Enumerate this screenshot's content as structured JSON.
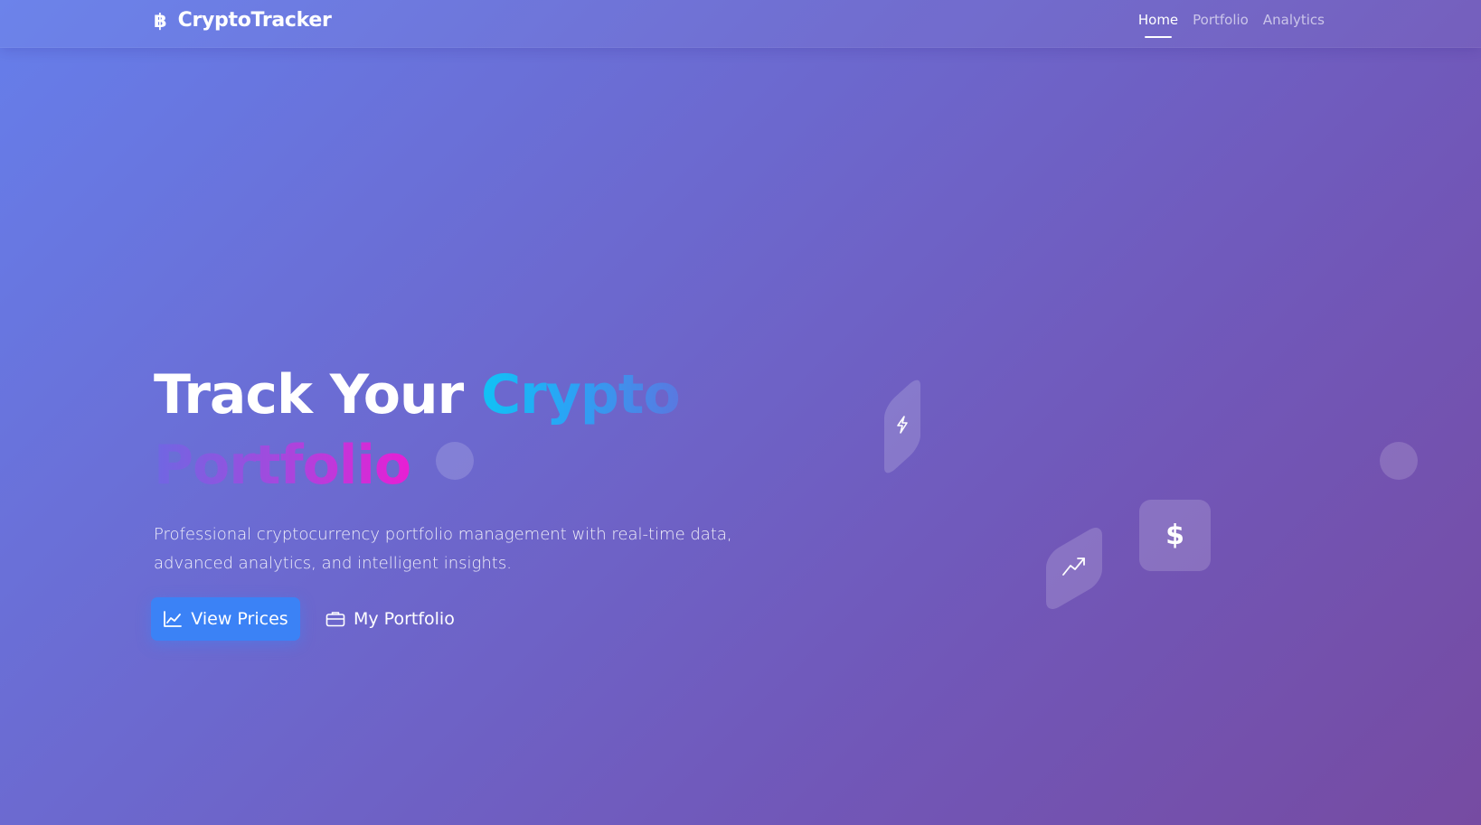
{
  "navbar": {
    "brand_icon": "฿",
    "brand_name": "CryptoTracker",
    "links": [
      {
        "label": "Home",
        "active": true
      },
      {
        "label": "Portfolio",
        "active": false
      },
      {
        "label": "Analytics",
        "active": false
      }
    ]
  },
  "hero": {
    "title_part1": "Track Your ",
    "title_part2": "Crypto",
    "title_part3": "Portfolio",
    "description": "Professional cryptocurrency portfolio management with real-time data, advanced analytics, and intelligent insights.",
    "primary_button": {
      "label": "View Prices",
      "icon": "chart-line-icon"
    },
    "secondary_button": {
      "label": "My Portfolio",
      "icon": "briefcase-icon"
    }
  },
  "decorations": {
    "bolt_card_icon": "lightning-icon",
    "trend_card_icon": "trending-up-icon",
    "dollar_card_text": "$"
  },
  "colors": {
    "background_start": "#667eea",
    "background_end": "#764ba2",
    "primary_button": "#3b82f6",
    "crypto_gradient": [
      "#11c2f5",
      "#5a78e0"
    ],
    "portfolio_gradient": [
      "#6f67e2",
      "#e81fd4"
    ]
  }
}
